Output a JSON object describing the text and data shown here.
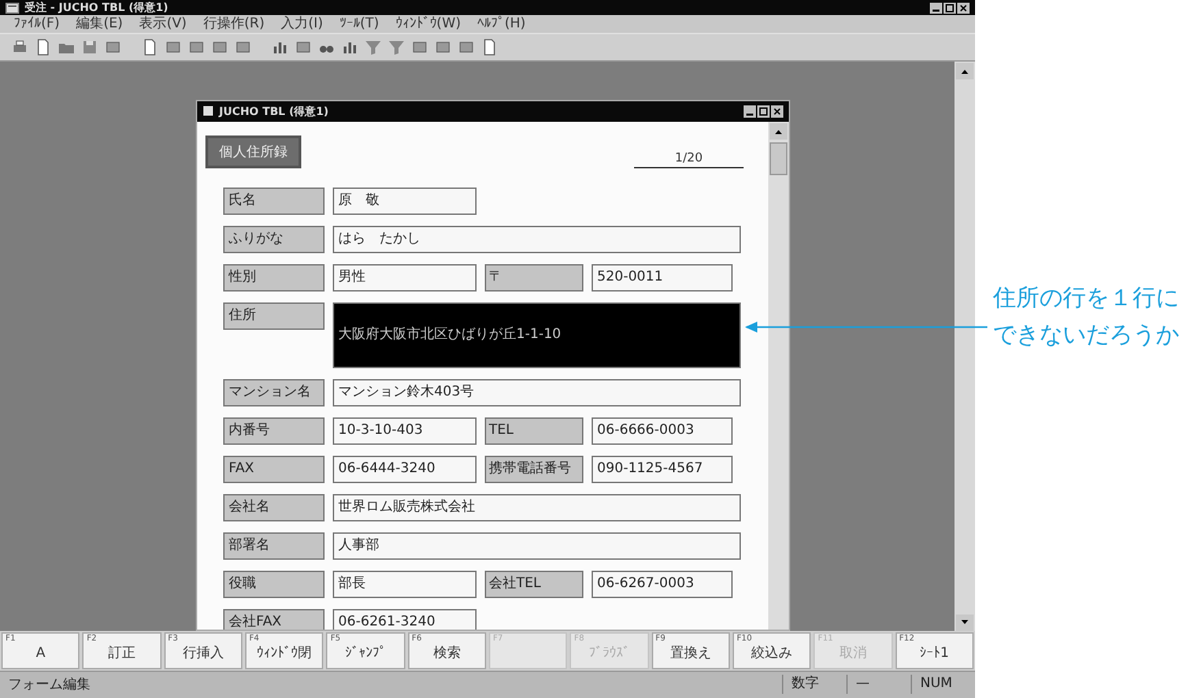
{
  "window": {
    "title": "受注 - JUCHO TBL (得意1)"
  },
  "menu": [
    "ﾌｧｲﾙ(F)",
    "編集(E)",
    "表示(V)",
    "行操作(R)",
    "入力(I)",
    "ﾂｰﾙ(T)",
    "ｳｨﾝﾄﾞｳ(W)",
    "ﾍﾙﾌﾟ(H)"
  ],
  "form_window": {
    "title": "JUCHO TBL (得意1)",
    "heading": "個人住所録",
    "page": "1/20",
    "rows": [
      {
        "kind": "short",
        "fields": [
          {
            "label": "氏名",
            "value": "原　敬",
            "highlighted": false
          }
        ]
      },
      {
        "kind": "full",
        "fields": [
          {
            "label": "ふりがな",
            "value": "はら　たかし",
            "highlighted": false
          }
        ]
      },
      {
        "kind": "pair",
        "fields": [
          {
            "label": "性別",
            "value": "男性",
            "highlighted": false
          },
          {
            "label": "〒",
            "value": "520-0011",
            "highlighted": false
          }
        ]
      },
      {
        "kind": "tall",
        "fields": [
          {
            "label": "住所",
            "value": "大阪府大阪市北区ひばりが丘1-1-10",
            "highlighted": true
          }
        ]
      },
      {
        "kind": "full",
        "fields": [
          {
            "label": "マンション名",
            "value": "マンション鈴木403号",
            "highlighted": false
          }
        ]
      },
      {
        "kind": "pair",
        "fields": [
          {
            "label": "内番号",
            "value": "10-3-10-403",
            "highlighted": false
          },
          {
            "label": "TEL",
            "value": "06-6666-0003",
            "highlighted": false
          }
        ]
      },
      {
        "kind": "pair",
        "fields": [
          {
            "label": "FAX",
            "value": "06-6444-3240",
            "highlighted": false
          },
          {
            "label": "携帯電話番号",
            "value": "090-1125-4567",
            "highlighted": false
          }
        ]
      },
      {
        "kind": "full",
        "fields": [
          {
            "label": "会社名",
            "value": "世界ロム販売株式会社",
            "highlighted": false
          }
        ]
      },
      {
        "kind": "full",
        "fields": [
          {
            "label": "部署名",
            "value": "人事部",
            "highlighted": false
          }
        ]
      },
      {
        "kind": "pair",
        "fields": [
          {
            "label": "役職",
            "value": "部長",
            "highlighted": false
          },
          {
            "label": "会社TEL",
            "value": "06-6267-0003",
            "highlighted": false
          }
        ]
      },
      {
        "kind": "short",
        "fields": [
          {
            "label": "会社FAX",
            "value": "06-6261-3240",
            "highlighted": false
          }
        ]
      }
    ]
  },
  "function_keys": [
    {
      "key": "F1",
      "label": "A",
      "disabled": false
    },
    {
      "key": "F2",
      "label": "訂正",
      "disabled": false
    },
    {
      "key": "F3",
      "label": "行挿入",
      "disabled": false
    },
    {
      "key": "F4",
      "label": "ｳｨﾝﾄﾞｳ閉",
      "disabled": false
    },
    {
      "key": "F5",
      "label": "ｼﾞｬﾝﾌﾟ",
      "disabled": false
    },
    {
      "key": "F6",
      "label": "検索",
      "disabled": false
    },
    {
      "key": "F7",
      "disabled": true
    },
    {
      "key": "F8",
      "label": "ﾌﾞﾗｳｽﾞ",
      "disabled": true
    },
    {
      "key": "F9",
      "label": "置換え",
      "disabled": false
    },
    {
      "key": "F10",
      "label": "絞込み",
      "disabled": false
    },
    {
      "key": "F11",
      "label": "取消",
      "disabled": true
    },
    {
      "key": "F12",
      "label": "ｼｰﾄ1",
      "disabled": false
    }
  ],
  "status_bar": {
    "message": "フォーム編集",
    "cells": [
      "数字",
      "—",
      "NUM"
    ]
  },
  "annotation": {
    "text": "住所の行を１行にできないだろうか"
  }
}
